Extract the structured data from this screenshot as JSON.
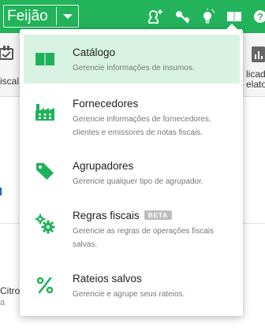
{
  "topbar": {
    "company": "Feijão",
    "icons": [
      "user-add-icon",
      "key-icon",
      "lightbulb-icon",
      "book-icon",
      "help-icon"
    ]
  },
  "background": {
    "left_label": "iscal",
    "right_label_1": "licad",
    "right_label_2": "elato",
    "lower_title": "Citro",
    "lower_sub": "a"
  },
  "menu": {
    "items": [
      {
        "title": "Catálogo",
        "description": "Gerencie informações de insumos.",
        "icon": "book-icon",
        "badge": ""
      },
      {
        "title": "Fornecedores",
        "description": "Gerencie informações de fornecedores, clientes e emissores de notas fiscais.",
        "icon": "factory-icon",
        "badge": ""
      },
      {
        "title": "Agrupadores",
        "description": "Gerencie qualquer tipo de agrupador.",
        "icon": "tag-icon",
        "badge": ""
      },
      {
        "title": "Regras fiscais",
        "description": "Gerencie as regras de operações fiscais salvas.",
        "icon": "gears-icon",
        "badge": "BETA"
      },
      {
        "title": "Rateios salvos",
        "description": "Gerencie e agrupe seus rateios.",
        "icon": "percent-icon",
        "badge": ""
      }
    ]
  },
  "colors": {
    "brand_green": "#22b35b",
    "highlight": "#d8f3e3",
    "icon_green": "#1fb25a"
  }
}
